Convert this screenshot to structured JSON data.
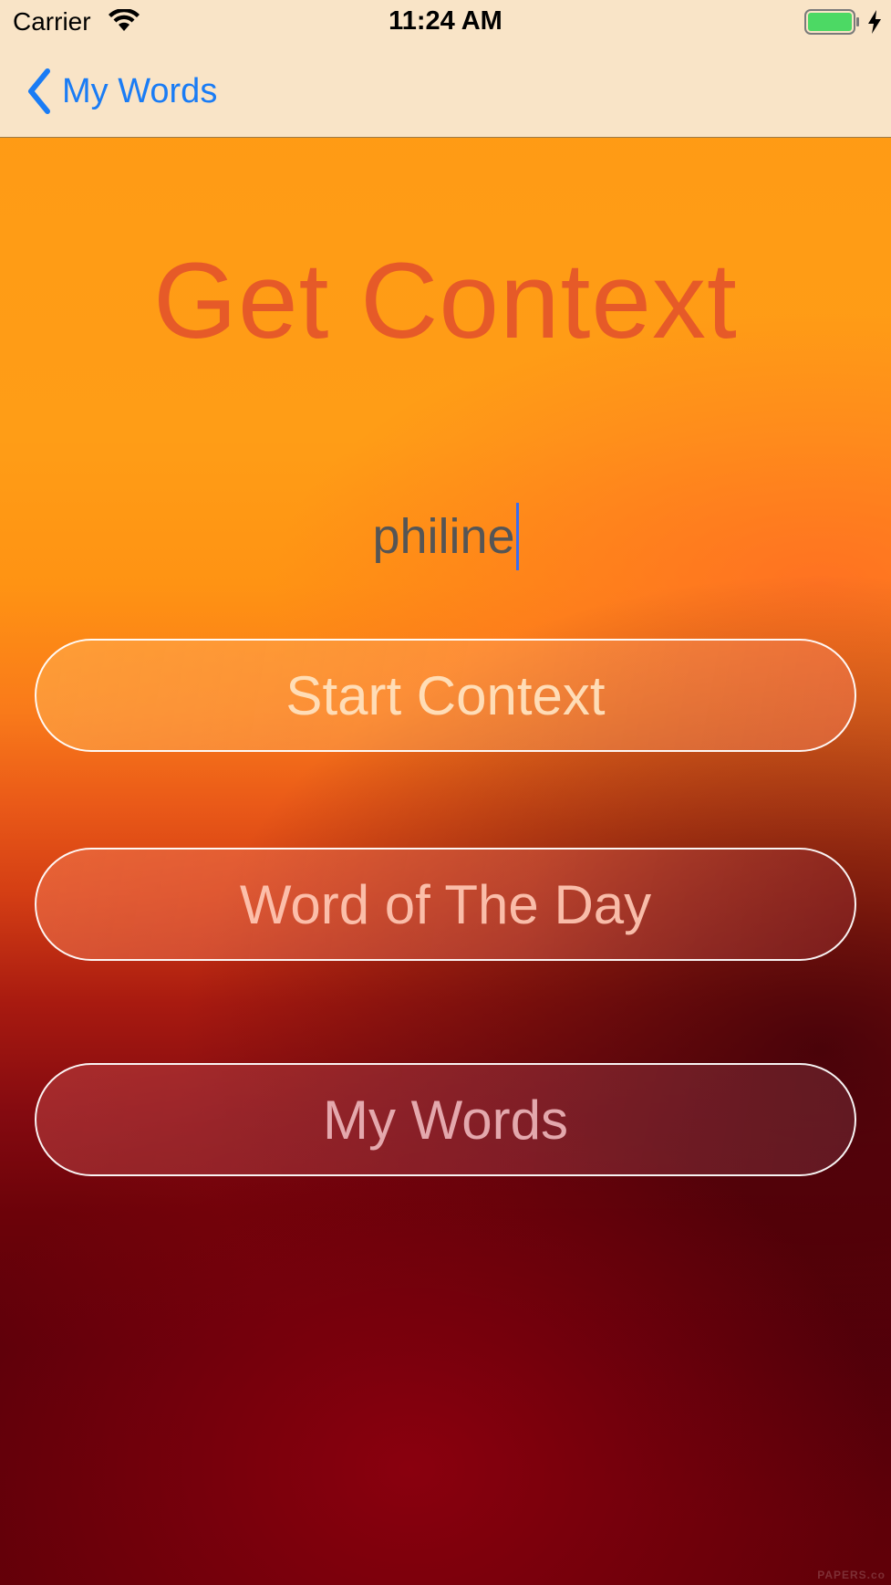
{
  "status_bar": {
    "carrier": "Carrier",
    "time": "11:24 AM",
    "battery_icon": "battery-full-icon",
    "charging_icon": "charging-bolt-icon",
    "wifi_icon": "wifi-icon"
  },
  "nav_bar": {
    "back_label": "My Words",
    "back_icon": "chevron-left-icon"
  },
  "main": {
    "title": "Get Context",
    "word_input_value": "philine",
    "buttons": {
      "start_context": "Start Context",
      "word_of_the_day": "Word of The Day",
      "my_words": "My Words"
    }
  },
  "watermark": "PAPERS.co",
  "colors": {
    "nav_background": "#f9e4c7",
    "link_blue": "#1a7cf5",
    "title_orange": "#e65a28",
    "caret_blue": "#3a6cf0"
  }
}
